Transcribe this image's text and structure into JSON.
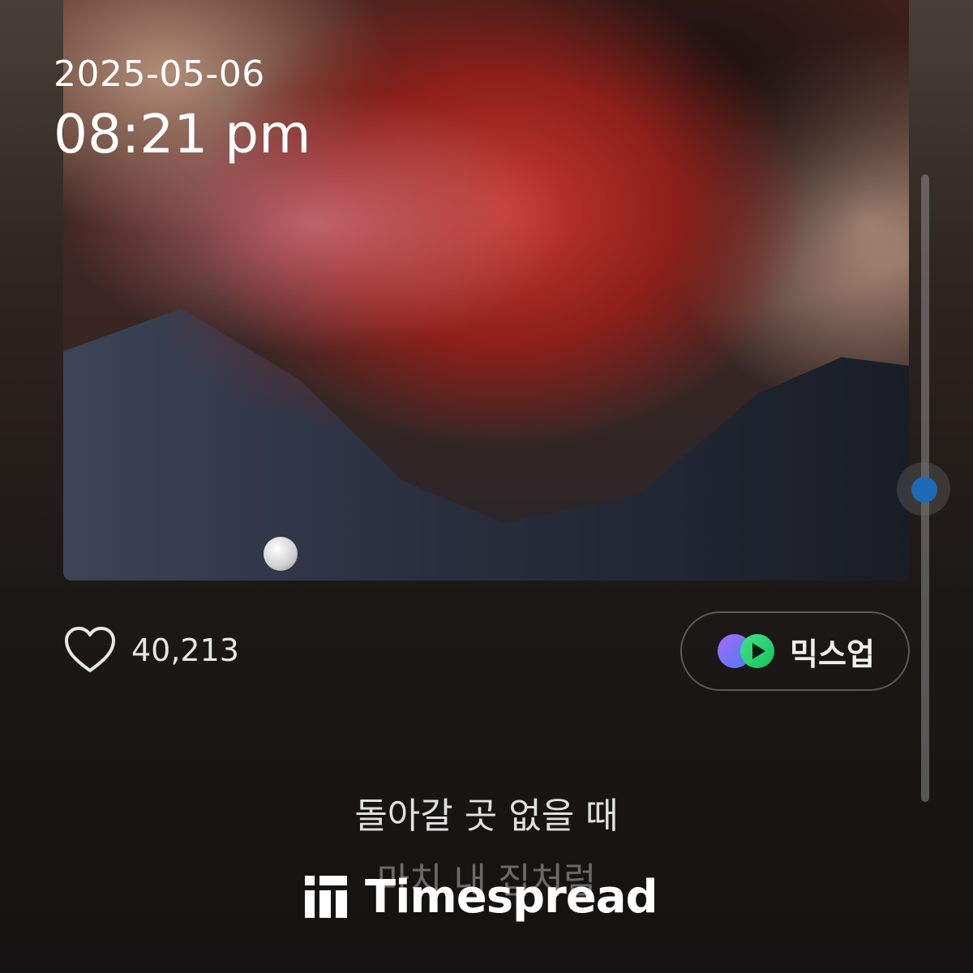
{
  "status": {
    "date": "2025-05-06",
    "time": "08:21 pm"
  },
  "album_art": {
    "icon": "album-cover-image"
  },
  "actions": {
    "like_icon": "heart-outline-icon",
    "like_count": "40,213",
    "mixup_icon": "mixup-play-icon",
    "mixup_label": "믹스업"
  },
  "lyrics": {
    "current": "돌아갈 곳 없을 때",
    "next": "마치 내 집처럼"
  },
  "watermark": {
    "icon": "timespread-logo-icon",
    "text": "Timespread"
  },
  "scrollbar": {
    "position": 0.48
  },
  "colors": {
    "accent_blue": "#1e6ab5",
    "background_top": "#4a3f38",
    "background_bottom": "#141212",
    "mixup_purple": "#7b5cf0",
    "mixup_green": "#1ed760"
  }
}
